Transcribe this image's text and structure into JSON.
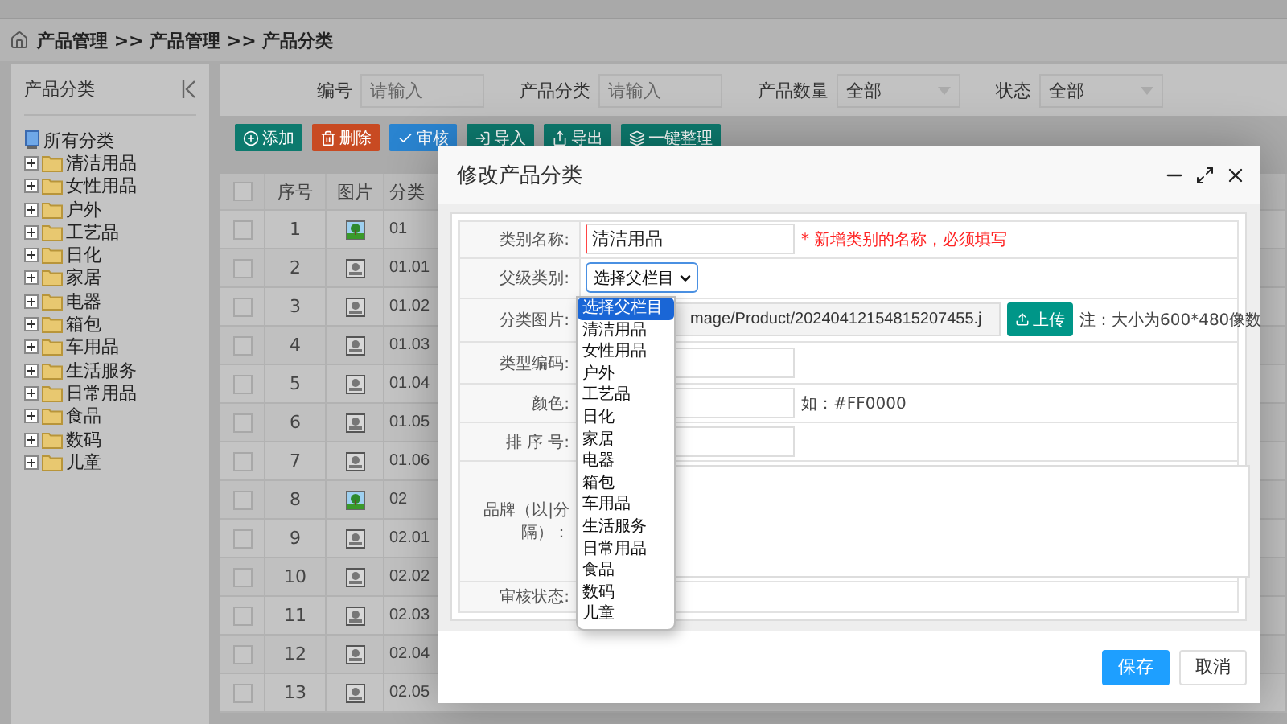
{
  "breadcrumb": "产品管理 >> 产品管理 >> 产品分类",
  "sidebar": {
    "title": "产品分类",
    "root": "所有分类",
    "items": [
      {
        "label": "清洁用品"
      },
      {
        "label": "女性用品"
      },
      {
        "label": "户外"
      },
      {
        "label": "工艺品"
      },
      {
        "label": "日化"
      },
      {
        "label": "家居"
      },
      {
        "label": "电器"
      },
      {
        "label": "箱包"
      },
      {
        "label": "车用品"
      },
      {
        "label": "生活服务"
      },
      {
        "label": "日常用品"
      },
      {
        "label": "食品"
      },
      {
        "label": "数码"
      },
      {
        "label": "儿童"
      }
    ]
  },
  "filters": [
    {
      "kind": "text",
      "label": "编号",
      "placeholder": "请输入"
    },
    {
      "kind": "text",
      "label": "产品分类",
      "placeholder": "请输入"
    },
    {
      "kind": "select",
      "label": "产品数量",
      "value": "全部"
    },
    {
      "kind": "select",
      "label": "状态",
      "value": "全部"
    }
  ],
  "toolbar": [
    {
      "label": "添加",
      "color": "#0d7a6e"
    },
    {
      "label": "删除",
      "color": "#c84a22"
    },
    {
      "label": "审核",
      "color": "#2a84d0"
    },
    {
      "label": "导入",
      "color": "#0d7a6e"
    },
    {
      "label": "导出",
      "color": "#0d7a6e"
    },
    {
      "label": "一键整理",
      "color": "#0d7a6e"
    }
  ],
  "table": {
    "columns": [
      "序号",
      "图片",
      "分类"
    ],
    "all_checked": false,
    "rows": [
      {
        "checked": false,
        "index": "1",
        "has_image": true,
        "code": "01"
      },
      {
        "checked": false,
        "index": "2",
        "has_image": false,
        "code": "01.01"
      },
      {
        "checked": false,
        "index": "3",
        "has_image": false,
        "code": "01.02"
      },
      {
        "checked": false,
        "index": "4",
        "has_image": false,
        "code": "01.03"
      },
      {
        "checked": false,
        "index": "5",
        "has_image": false,
        "code": "01.04"
      },
      {
        "checked": false,
        "index": "6",
        "has_image": false,
        "code": "01.05"
      },
      {
        "checked": false,
        "index": "7",
        "has_image": false,
        "code": "01.06"
      },
      {
        "checked": false,
        "index": "8",
        "has_image": true,
        "code": "02"
      },
      {
        "checked": false,
        "index": "9",
        "has_image": false,
        "code": "02.01"
      },
      {
        "checked": false,
        "index": "10",
        "has_image": false,
        "code": "02.02"
      },
      {
        "checked": false,
        "index": "11",
        "has_image": false,
        "code": "02.03"
      },
      {
        "checked": false,
        "index": "12",
        "has_image": false,
        "code": "02.04"
      },
      {
        "checked": false,
        "index": "13",
        "has_image": false,
        "code": "02.05"
      }
    ]
  },
  "modal": {
    "title": "修改产品分类",
    "fields": [
      {
        "kind": "text",
        "label": "类别名称:",
        "value": "清洁用品",
        "required": true,
        "hint": "* 新增类别的名称，必须填写"
      },
      {
        "kind": "select",
        "label": "父级类别:",
        "value": "选择父栏目"
      },
      {
        "kind": "file",
        "label": "分类图片:",
        "value": "mage/Product/20240412154815207455.j",
        "button": "上传",
        "note": "注：大小为600*480像数"
      },
      {
        "kind": "text",
        "label": "类型编码:"
      },
      {
        "kind": "text",
        "label": "颜色:",
        "hint": "如：#FF0000"
      },
      {
        "kind": "text",
        "label": "排 序 号:"
      },
      {
        "kind": "textarea",
        "label": "品牌（以|分隔）："
      },
      {
        "kind": "status",
        "label": "审核状态:"
      }
    ],
    "buttons": [
      {
        "label": "保存",
        "primary": true
      },
      {
        "label": "取消",
        "primary": false
      }
    ]
  },
  "dropdown": {
    "options": [
      {
        "label": "选择父栏目",
        "selected": true
      },
      {
        "label": "清洁用品",
        "selected": false
      },
      {
        "label": "女性用品",
        "selected": false
      },
      {
        "label": "户外",
        "selected": false
      },
      {
        "label": "工艺品",
        "selected": false
      },
      {
        "label": "日化",
        "selected": false
      },
      {
        "label": "家居",
        "selected": false
      },
      {
        "label": "电器",
        "selected": false
      },
      {
        "label": "箱包",
        "selected": false
      },
      {
        "label": "车用品",
        "selected": false
      },
      {
        "label": "生活服务",
        "selected": false
      },
      {
        "label": "日常用品",
        "selected": false
      },
      {
        "label": "食品",
        "selected": false
      },
      {
        "label": "数码",
        "selected": false
      },
      {
        "label": "儿童",
        "selected": false
      }
    ]
  }
}
